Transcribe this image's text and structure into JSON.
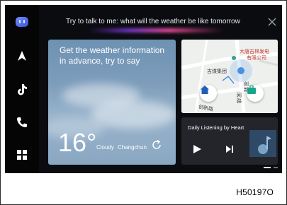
{
  "voice_assistant": {
    "prompt": "Try to talk to me: what will the weather be like tomorrow"
  },
  "weather_card": {
    "prompt": "Get the weather information in advance, try to say",
    "temperature": "16°",
    "condition": "Cloudy",
    "city": "Changchun"
  },
  "map_card": {
    "labels": [
      "大唐吉林发电",
      "有限公司",
      "吉煤集团",
      "创",
      "新",
      "网",
      "路",
      "创新路"
    ]
  },
  "music_card": {
    "title": "Daily Listening by Heart"
  },
  "pagination": {
    "total": 2,
    "current": 1
  },
  "figure_code": "H50197O",
  "colors": {
    "screen_bg": "#0b0c10",
    "home_button": "#1f5fb8",
    "company_button": "#1aa58a",
    "route_blue": "#4a90e2"
  },
  "icons": [
    "voice-assistant-icon",
    "navigation-icon",
    "music-app-icon",
    "phone-icon",
    "apps-grid-icon",
    "close-icon",
    "refresh-icon",
    "home-icon",
    "briefcase-icon",
    "play-icon",
    "next-track-icon"
  ]
}
